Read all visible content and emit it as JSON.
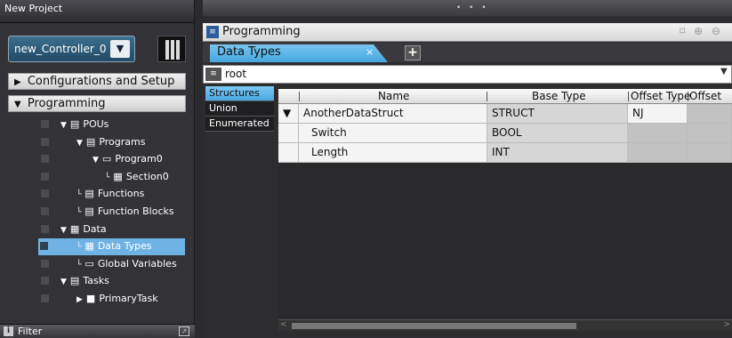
{
  "left_panel": {
    "title": "New Project",
    "controller": {
      "name": "new_Controller_0",
      "arrow": "▼"
    },
    "sections": {
      "configurations": {
        "arrow": "▶",
        "label": "Configurations and Setup"
      },
      "programming": {
        "arrow": "▼",
        "label": "Programming"
      }
    },
    "tree": [
      {
        "arrow": "▼",
        "icon": "▤",
        "label": "POUs",
        "indent": 0
      },
      {
        "arrow": "▼",
        "icon": "▤",
        "label": "Programs",
        "indent": 1
      },
      {
        "arrow": "▼",
        "icon": "▭",
        "label": "Program0",
        "indent": 2
      },
      {
        "arrow": "└",
        "icon": "▦",
        "label": "Section0",
        "indent": 3
      },
      {
        "arrow": "└",
        "icon": "▤",
        "label": "Functions",
        "indent": 1
      },
      {
        "arrow": "└",
        "icon": "▤",
        "label": "Function Blocks",
        "indent": 1
      },
      {
        "arrow": "▼",
        "icon": "▦",
        "label": "Data",
        "indent": 0
      },
      {
        "arrow": "└",
        "icon": "▦",
        "label": "Data Types",
        "indent": 1,
        "selected": true
      },
      {
        "arrow": "└",
        "icon": "▭",
        "label": "Global Variables",
        "indent": 1
      },
      {
        "arrow": "▼",
        "icon": "▤",
        "label": "Tasks",
        "indent": 0
      },
      {
        "arrow": "▶",
        "icon": "■",
        "label": "PrimaryTask",
        "indent": 1
      }
    ],
    "filter": {
      "icon": "i",
      "label": "Filter",
      "button": "↗"
    }
  },
  "right_panel": {
    "dots": "• • •",
    "programming_title": "Programming",
    "programming_icon": "≡",
    "tools": "⌑ ⊕ ⊖",
    "tab": {
      "label": "Data Types",
      "close": "×"
    },
    "add_tab": "+",
    "path": {
      "icon": "≡",
      "label": "root",
      "dropdown": "▼"
    },
    "vertical_tabs": [
      "Structures",
      "Union",
      "Enumerated"
    ],
    "columns": [
      "Name",
      "Base Type",
      "Offset Type",
      "Offset B"
    ],
    "rows": [
      {
        "toggle": "▼",
        "name": "AnotherDataStruct",
        "base_type": "STRUCT",
        "offset_type": "NJ"
      },
      {
        "toggle": "",
        "name": "Switch",
        "base_type": "BOOL",
        "offset_type": ""
      },
      {
        "toggle": "",
        "name": "Length",
        "base_type": "INT",
        "offset_type": ""
      }
    ],
    "scroll_left": "<",
    "scroll_right": ">"
  },
  "colors": {
    "accent_tab": "#46a6e0",
    "selected_tree": "#6fb3e5",
    "background": "#2d2d30"
  }
}
